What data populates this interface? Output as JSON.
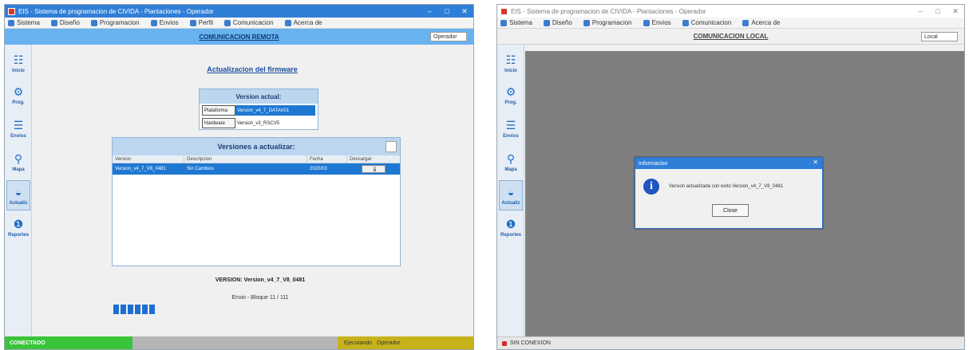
{
  "left": {
    "title": "EIS - Sistema de programacion de CIVIDA - Plantaciones - Operador",
    "menu": [
      {
        "label": "Sistema",
        "icon": "monitor-icon"
      },
      {
        "label": "Diseño",
        "icon": "pencil-icon"
      },
      {
        "label": "Programacion",
        "icon": "gear-icon"
      },
      {
        "label": "Envios",
        "icon": "send-icon"
      },
      {
        "label": "Perfil",
        "icon": "user-icon"
      },
      {
        "label": "Comunicacion",
        "icon": "network-icon"
      },
      {
        "label": "Acerca de",
        "icon": "info-icon"
      }
    ],
    "header": "COMUNICACION REMOTA",
    "user_combo": "Operador",
    "sidebar": [
      {
        "label": "Inicio",
        "icon": "home-icon"
      },
      {
        "label": "Prog.",
        "icon": "gear-icon"
      },
      {
        "label": "Envios",
        "icon": "list-icon"
      },
      {
        "label": "Mapa",
        "icon": "map-pin-icon"
      },
      {
        "label": "Actualiz",
        "icon": "download-icon"
      },
      {
        "label": "Reportes",
        "icon": "chart-icon"
      }
    ],
    "update_title": "Actualizacion del firmware",
    "current": {
      "heading": "Version actual:",
      "rows": [
        {
          "key": "Plataforma",
          "value": "Version_v4_7_DATAV01"
        },
        {
          "key": "Hardware",
          "value": "Version_v3_RSCV5"
        }
      ]
    },
    "versions": {
      "heading": "Versiones a actualizar:",
      "columns": [
        "Version",
        "Descripcion",
        "Fecha",
        "Descargar"
      ],
      "rows": [
        {
          "version": "Version_v4_7_V8_0481",
          "description": "Sin Cambios",
          "date": "2020/03",
          "action": "⇓"
        }
      ]
    },
    "status_text": "VERSION: Version_v4_7_V8_0481",
    "sending": "Envio - Bloque 11 / 111",
    "progress": 0.22,
    "statusbar": {
      "left": "CONECTADO",
      "right_a": "Ejecutando",
      "right_b": "Operador"
    }
  },
  "right": {
    "title": "EIS - Sistema de programacion de CIVIDA - Plantaciones - Operador",
    "menu": [
      {
        "label": "Sistema",
        "icon": "monitor-icon"
      },
      {
        "label": "Diseño",
        "icon": "pencil-icon"
      },
      {
        "label": "Programacion",
        "icon": "gear-icon"
      },
      {
        "label": "Envios",
        "icon": "send-icon"
      },
      {
        "label": "Comunicacion",
        "icon": "network-icon"
      },
      {
        "label": "Acerca de",
        "icon": "info-icon"
      }
    ],
    "header": "COMUNICACION LOCAL",
    "user_combo": "Local",
    "sidebar": [
      {
        "label": "Inicio",
        "icon": "home-icon"
      },
      {
        "label": "Prog.",
        "icon": "gear-icon"
      },
      {
        "label": "Envios",
        "icon": "list-icon"
      },
      {
        "label": "Mapa",
        "icon": "map-pin-icon"
      },
      {
        "label": "Actualiz",
        "icon": "download-icon"
      },
      {
        "label": "Reportes",
        "icon": "chart-icon"
      }
    ],
    "dialog": {
      "title": "Informacion",
      "message": "Version actualizada con exito Version_v4_7_V8_0481",
      "ok": "Close"
    },
    "statusbar": {
      "left": "SIN CONEXION"
    }
  },
  "colors": {
    "accent": "#2f7fd8",
    "header_left": "#68b2f0",
    "progress": "#1e6fcf",
    "status_green": "#39c43a",
    "status_yellow": "#c8b21a"
  }
}
